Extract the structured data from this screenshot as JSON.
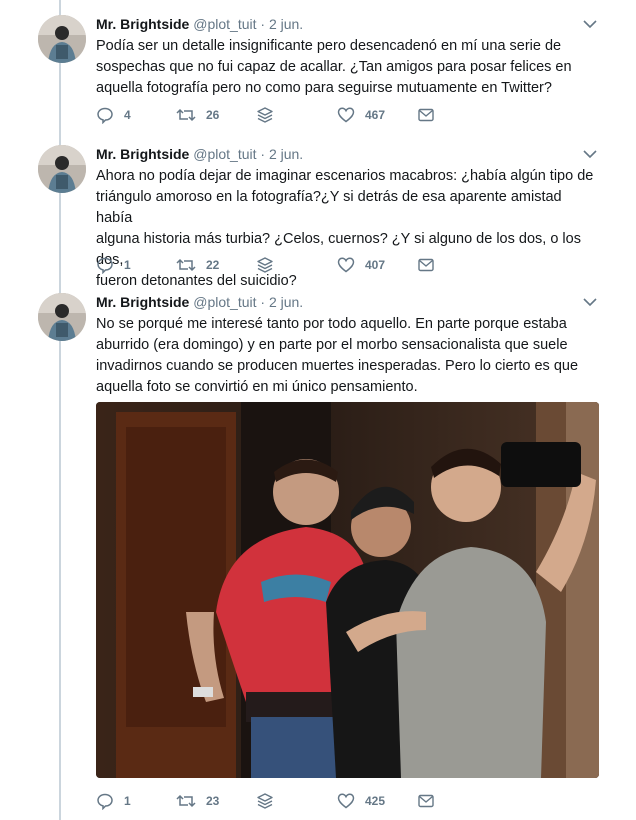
{
  "tweets": [
    {
      "name": "Mr. Brightside",
      "handle": "@plot_tuit",
      "separator": "·",
      "date": "2 jun.",
      "lines": [
        "Podía ser un detalle insignificante pero desencadenó en mí una serie de",
        "sospechas que no fui capaz de acallar. ¿Tan amigos para posar felices en",
        "aquella fotografía pero no como para seguirse mutuamente en Twitter?"
      ],
      "replies": "4",
      "retweets": "26",
      "likes": "467"
    },
    {
      "name": "Mr. Brightside",
      "handle": "@plot_tuit",
      "separator": "·",
      "date": "2 jun.",
      "lines": [
        "Ahora no podía dejar de imaginar escenarios macabros: ¿había algún tipo de",
        "triángulo amoroso en la fotografía?¿Y si detrás de esa aparente amistad había",
        "alguna historia más turbia? ¿Celos, cuernos? ¿Y si alguno de los dos, o los dos,",
        "fueron detonantes del suicidio?"
      ],
      "replies": "1",
      "retweets": "22",
      "likes": "407"
    },
    {
      "name": "Mr. Brightside",
      "handle": "@plot_tuit",
      "separator": "·",
      "date": "2 jun.",
      "lines": [
        "No se porqué me interesé tanto por todo aquello. En parte porque estaba",
        "aburrido (era domingo) y en parte por el morbo sensacionalista que suele",
        "invadirnos cuando se producen muertes inesperadas. Pero lo cierto es que",
        "aquella foto se convirtió en mi único pensamiento."
      ],
      "replies": "1",
      "retweets": "23",
      "likes": "425"
    }
  ],
  "colors": {
    "text": "#14171a",
    "muted": "#657786",
    "thread_line": "#cbd5dd"
  },
  "icons": [
    "reply-icon",
    "retweet-icon",
    "share-icon",
    "like-icon",
    "message-icon",
    "chevron-down-icon"
  ]
}
